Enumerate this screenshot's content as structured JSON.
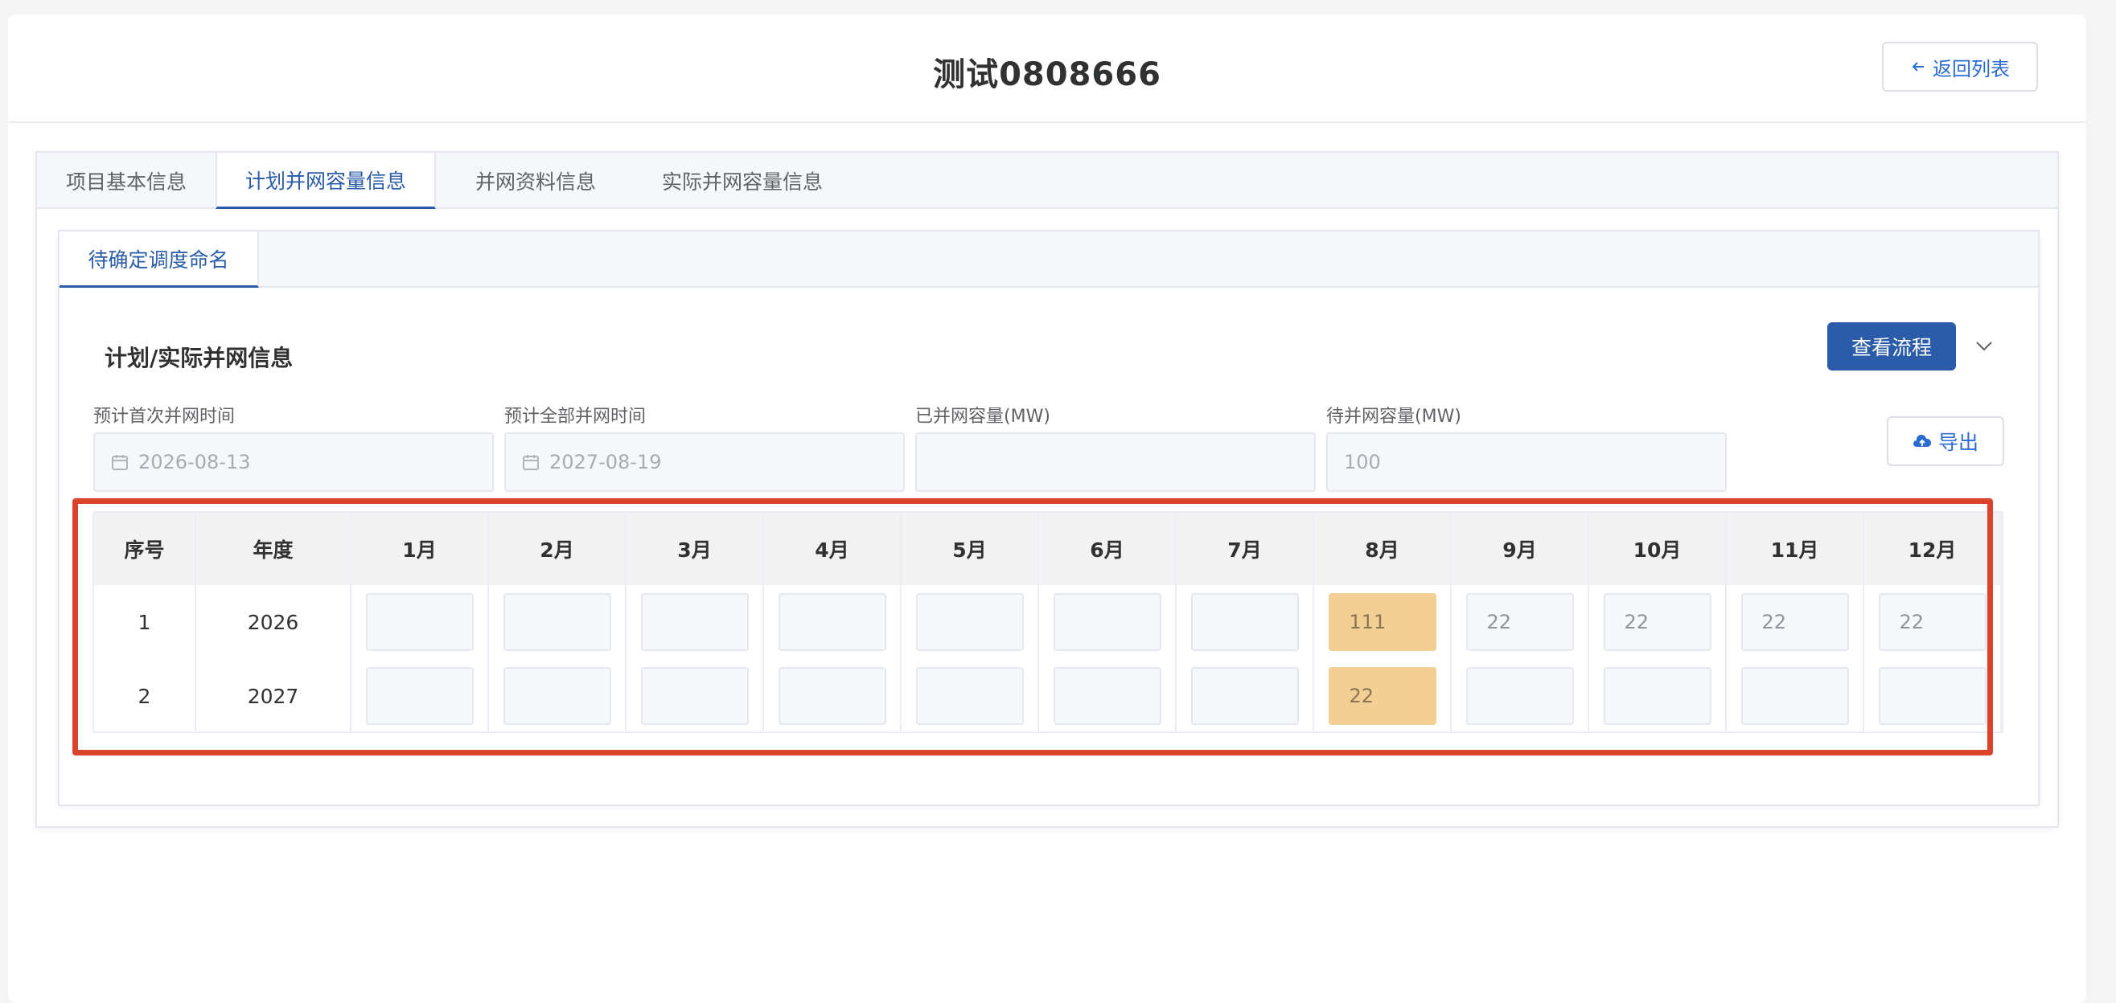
{
  "header": {
    "title": "测试0808666",
    "back_label": "返回列表"
  },
  "tabs": [
    {
      "label": "项目基本信息"
    },
    {
      "label": "计划并网容量信息"
    },
    {
      "label": "并网资料信息"
    },
    {
      "label": "实际并网容量信息"
    }
  ],
  "inner_tab": {
    "label": "待确定调度命名"
  },
  "section": {
    "title": "计划/实际并网信息",
    "flow_button": "查看流程",
    "export_button": "导出"
  },
  "fields": [
    {
      "label": "预计首次并网时间",
      "value": "2026-08-13"
    },
    {
      "label": "预计全部并网时间",
      "value": "2027-08-19"
    },
    {
      "label": "已并网容量(MW)",
      "value": ""
    },
    {
      "label": "待并网容量(MW)",
      "value": "100"
    }
  ],
  "table": {
    "headers": [
      "序号",
      "年度",
      "1月",
      "2月",
      "3月",
      "4月",
      "5月",
      "6月",
      "7月",
      "8月",
      "9月",
      "10月",
      "11月",
      "12月"
    ],
    "rows": [
      {
        "index": "1",
        "year": "2026",
        "months": [
          "",
          "",
          "",
          "",
          "",
          "",
          "",
          "111",
          "22",
          "22",
          "22",
          "22"
        ]
      },
      {
        "index": "2",
        "year": "2027",
        "months": [
          "",
          "",
          "",
          "",
          "",
          "",
          "",
          "22",
          "",
          "",
          "",
          ""
        ]
      }
    ]
  },
  "colors": {
    "primary": "#2a5caa",
    "highlight": "#f2cf94",
    "annotation": "#d9442b"
  }
}
